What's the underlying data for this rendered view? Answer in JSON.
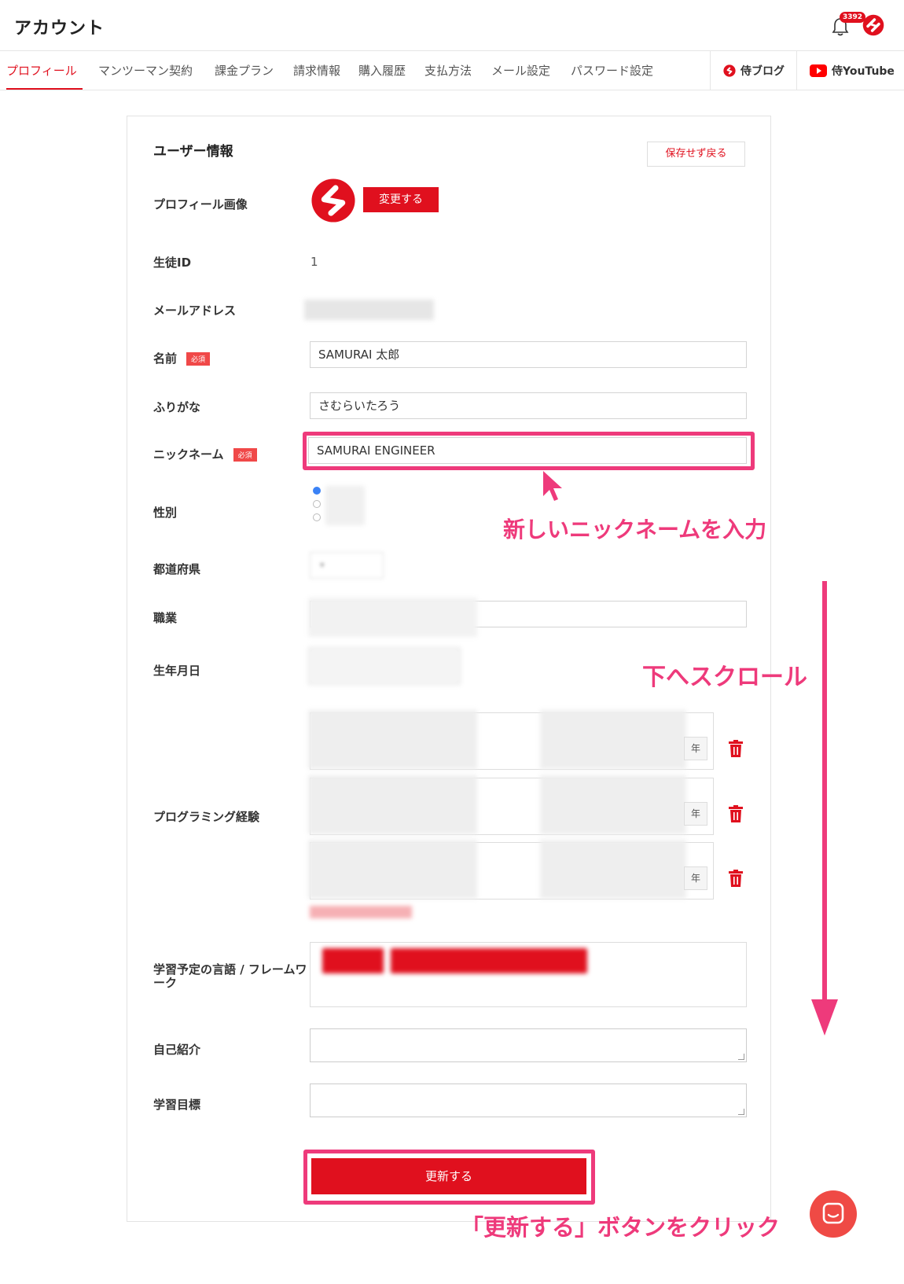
{
  "header": {
    "title": "アカウント",
    "notification_count": "3392"
  },
  "nav": {
    "tabs": [
      {
        "label": "プロフィール"
      },
      {
        "label": "マンツーマン契約"
      },
      {
        "label": "課金プラン"
      },
      {
        "label": "請求情報"
      },
      {
        "label": "購入履歴"
      },
      {
        "label": "支払方法"
      },
      {
        "label": "メール設定"
      },
      {
        "label": "パスワード設定"
      }
    ],
    "external": [
      {
        "label": "侍ブログ"
      },
      {
        "label": "侍YouTube"
      }
    ]
  },
  "form": {
    "section_title": "ユーザー情報",
    "back_label": "保存せず戻る",
    "required_badge": "必須",
    "profile_image_label": "プロフィール画像",
    "change_label": "変更する",
    "student_id_label": "生徒ID",
    "student_id_value": "1",
    "email_label": "メールアドレス",
    "name_label": "名前",
    "name_value": "SAMURAI 太郎",
    "furigana_label": "ふりがな",
    "furigana_value": "さむらいたろう",
    "nickname_label": "ニックネーム",
    "nickname_value": "SAMURAI ENGINEER",
    "gender_label": "性別",
    "prefecture_label": "都道府県",
    "occupation_label": "職業",
    "birthdate_label": "生年月日",
    "programming_experience_label": "プログラミング経験",
    "year_unit": "年",
    "languages_label": "学習予定の言語 / フレームワーク",
    "self_intro_label": "自己紹介",
    "goal_label": "学習目標",
    "update_label": "更新する"
  },
  "annotations": {
    "nickname_hint": "新しいニックネームを入力",
    "scroll_hint": "下へスクロール",
    "update_hint": "「更新する」ボタンをクリック"
  },
  "colors": {
    "brand": "#e0101e",
    "annotation": "#ee3a7b",
    "chat": "#ef4a45"
  }
}
